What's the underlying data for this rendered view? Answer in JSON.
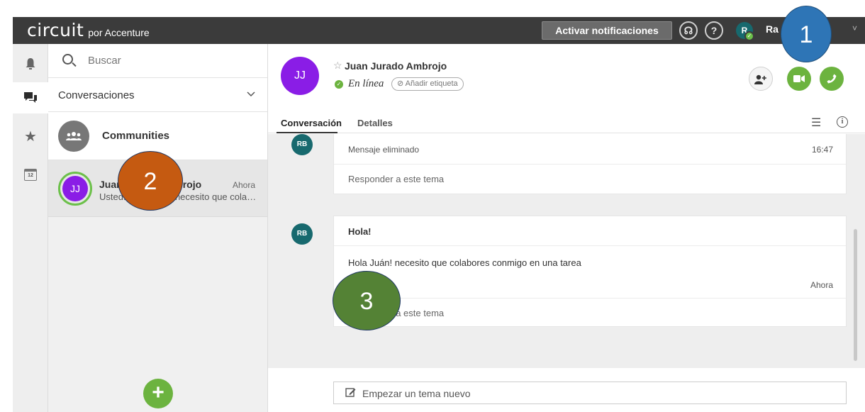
{
  "topbar": {
    "logo_main": "circuit",
    "logo_sub": "por Accenture",
    "notifications_button": "Activar notificaciones",
    "headset_icon": "headset-icon",
    "help_icon": "?",
    "user_avatar_initial": "R",
    "user_name": "Ra",
    "chevron": "˅"
  },
  "rail": {
    "items": [
      {
        "name": "bell-icon",
        "glyph": "🔔"
      },
      {
        "name": "chat-icon",
        "glyph": "💬"
      },
      {
        "name": "star-icon",
        "glyph": "★"
      },
      {
        "name": "calendar-icon",
        "glyph": "12"
      }
    ]
  },
  "sidebar": {
    "search_placeholder": "Buscar",
    "filter_label": "Conversaciones",
    "filter_chevron": "⌄",
    "communities_label": "Communities",
    "conversation": {
      "initials": "JJ",
      "name": "Juan Jurado Ambrojo",
      "time": "Ahora",
      "preview": "Usted: Hola Juán! necesito que colabores conmigo en una tarea"
    },
    "add_button": "+"
  },
  "contact": {
    "initials": "JJ",
    "star": "☆",
    "name": "Juan Jurado Ambrojo",
    "status": "En línea",
    "tag_button": "Añadir etiqueta"
  },
  "actions": {
    "add_user": "add-user",
    "video": "video",
    "call": "call"
  },
  "tabs": {
    "conversation": "Conversación",
    "details": "Detalles"
  },
  "thread": {
    "card1": {
      "avatar": "RB",
      "deleted_text": "Mensaje eliminado",
      "time": "16:47",
      "reply": "Responder a este tema"
    },
    "card2": {
      "avatar": "RB",
      "title": "Hola!",
      "body": "Hola Juán! necesito que colabores conmigo en una tarea",
      "actions": "… ⊘ ···",
      "time": "Ahora",
      "reply": "Responder a este tema"
    }
  },
  "composer": {
    "placeholder": "Empezar un tema nuevo"
  },
  "callouts": {
    "one": "1",
    "two": "2",
    "three": "3"
  },
  "colors": {
    "topbar": "#3b3b3b",
    "accent_green": "#6cb33f",
    "avatar_purple": "#8a1de6",
    "avatar_teal": "#17696e",
    "callout_blue": "#2e75b6",
    "callout_orange": "#c55a11",
    "callout_green": "#548235"
  }
}
